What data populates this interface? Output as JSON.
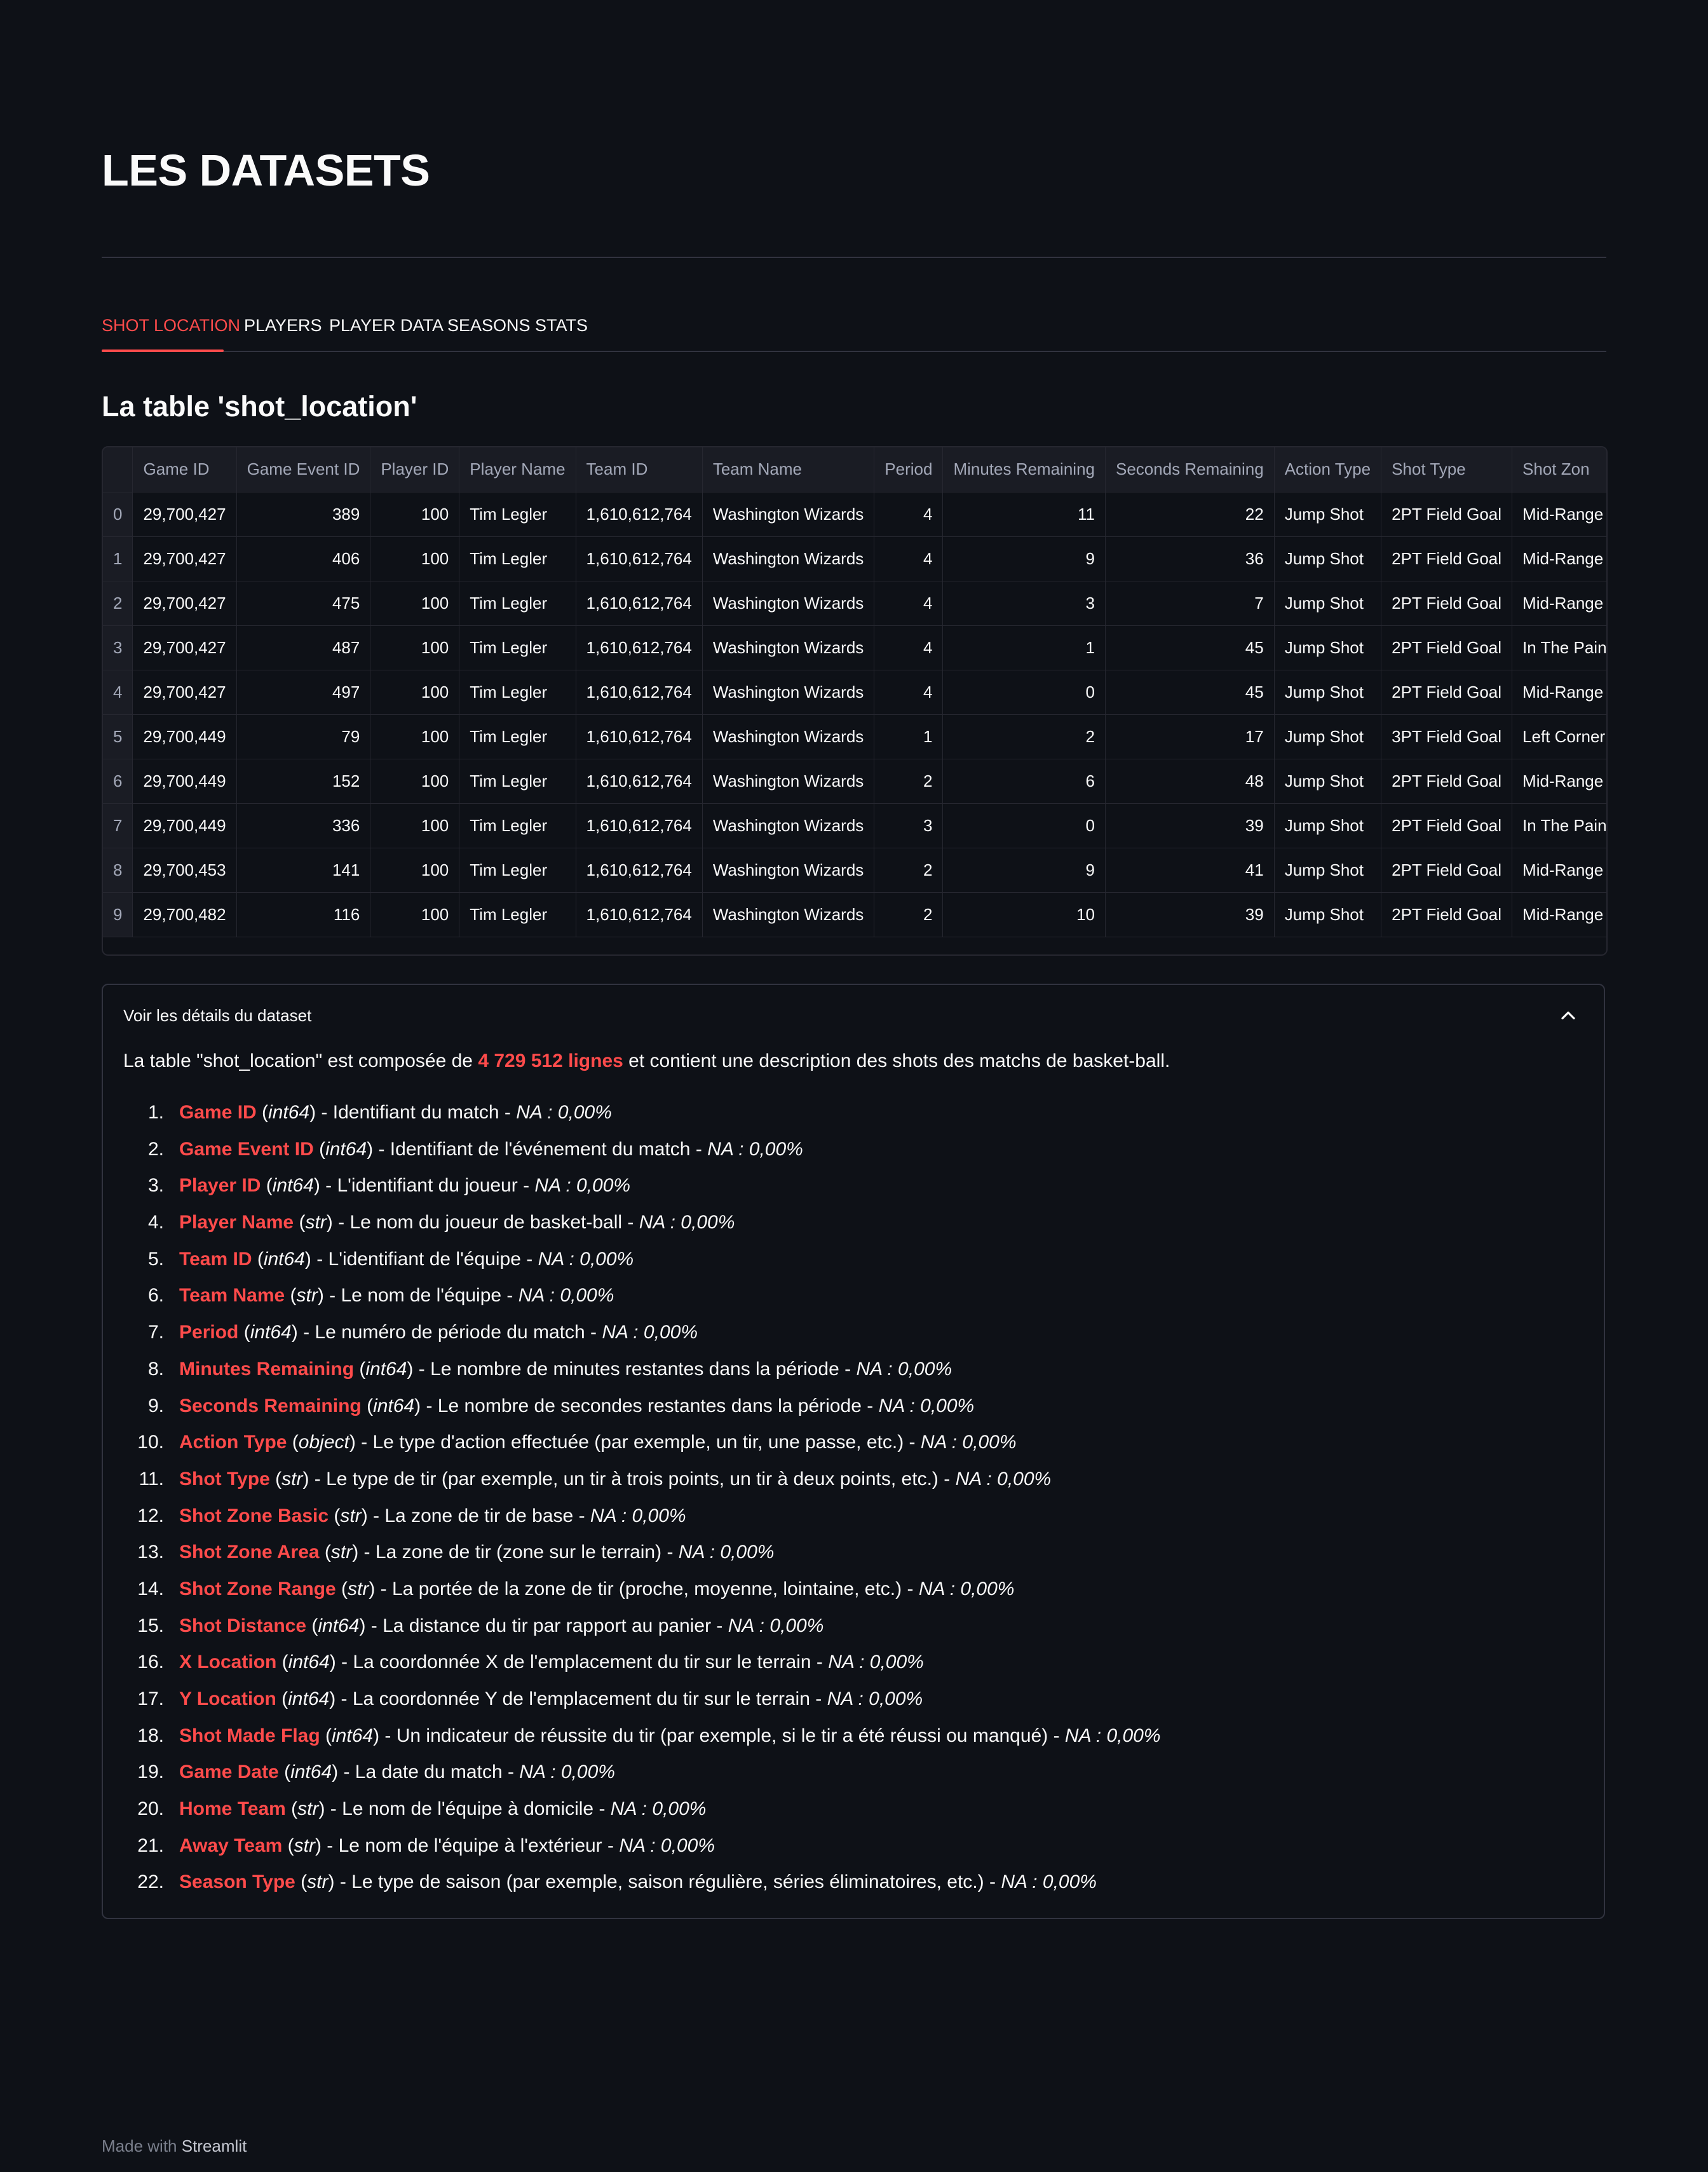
{
  "page": {
    "title": "LES DATASETS"
  },
  "tabs": [
    {
      "label": "SHOT LOCATION",
      "active": true
    },
    {
      "label": "PLAYERS",
      "active": false
    },
    {
      "label": "PLAYER DATA",
      "active": false
    },
    {
      "label": "SEASONS STATS",
      "active": false
    }
  ],
  "section": {
    "title": "La table 'shot_location'"
  },
  "table": {
    "columns": [
      "",
      "Game ID",
      "Game Event ID",
      "Player ID",
      "Player Name",
      "Team ID",
      "Team Name",
      "Period",
      "Minutes Remaining",
      "Seconds Remaining",
      "Action Type",
      "Shot Type",
      "Shot Zon"
    ],
    "rows": [
      [
        "0",
        "29,700,427",
        "389",
        "100",
        "Tim Legler",
        "1,610,612,764",
        "Washington Wizards",
        "4",
        "11",
        "22",
        "Jump Shot",
        "2PT Field Goal",
        "Mid-Range"
      ],
      [
        "1",
        "29,700,427",
        "406",
        "100",
        "Tim Legler",
        "1,610,612,764",
        "Washington Wizards",
        "4",
        "9",
        "36",
        "Jump Shot",
        "2PT Field Goal",
        "Mid-Range"
      ],
      [
        "2",
        "29,700,427",
        "475",
        "100",
        "Tim Legler",
        "1,610,612,764",
        "Washington Wizards",
        "4",
        "3",
        "7",
        "Jump Shot",
        "2PT Field Goal",
        "Mid-Range"
      ],
      [
        "3",
        "29,700,427",
        "487",
        "100",
        "Tim Legler",
        "1,610,612,764",
        "Washington Wizards",
        "4",
        "1",
        "45",
        "Jump Shot",
        "2PT Field Goal",
        "In The Paint"
      ],
      [
        "4",
        "29,700,427",
        "497",
        "100",
        "Tim Legler",
        "1,610,612,764",
        "Washington Wizards",
        "4",
        "0",
        "45",
        "Jump Shot",
        "2PT Field Goal",
        "Mid-Range"
      ],
      [
        "5",
        "29,700,449",
        "79",
        "100",
        "Tim Legler",
        "1,610,612,764",
        "Washington Wizards",
        "1",
        "2",
        "17",
        "Jump Shot",
        "3PT Field Goal",
        "Left Corner"
      ],
      [
        "6",
        "29,700,449",
        "152",
        "100",
        "Tim Legler",
        "1,610,612,764",
        "Washington Wizards",
        "2",
        "6",
        "48",
        "Jump Shot",
        "2PT Field Goal",
        "Mid-Range"
      ],
      [
        "7",
        "29,700,449",
        "336",
        "100",
        "Tim Legler",
        "1,610,612,764",
        "Washington Wizards",
        "3",
        "0",
        "39",
        "Jump Shot",
        "2PT Field Goal",
        "In The Paint"
      ],
      [
        "8",
        "29,700,453",
        "141",
        "100",
        "Tim Legler",
        "1,610,612,764",
        "Washington Wizards",
        "2",
        "9",
        "41",
        "Jump Shot",
        "2PT Field Goal",
        "Mid-Range"
      ],
      [
        "9",
        "29,700,482",
        "116",
        "100",
        "Tim Legler",
        "1,610,612,764",
        "Washington Wizards",
        "2",
        "10",
        "39",
        "Jump Shot",
        "2PT Field Goal",
        "Mid-Range"
      ]
    ]
  },
  "expander": {
    "label": "Voir les détails du dataset",
    "intro_before": "La table \"shot_location\" est composée de ",
    "intro_highlight": "4 729 512 lignes",
    "intro_after": " et contient une description des shots des matchs de basket-ball.",
    "fields": [
      {
        "name": "Game ID",
        "type": "int64",
        "desc": "Identifiant du match",
        "na": "NA : 0,00%"
      },
      {
        "name": "Game Event ID",
        "type": "int64",
        "desc": "Identifiant de l'événement du match",
        "na": "NA : 0,00%"
      },
      {
        "name": "Player ID",
        "type": "int64",
        "desc": "L'identifiant du joueur",
        "na": "NA : 0,00%"
      },
      {
        "name": "Player Name",
        "type": "str",
        "desc": "Le nom du joueur de basket-ball",
        "na": "NA : 0,00%"
      },
      {
        "name": "Team ID",
        "type": "int64",
        "desc": "L'identifiant de l'équipe",
        "na": "NA : 0,00%"
      },
      {
        "name": "Team Name",
        "type": "str",
        "desc": "Le nom de l'équipe",
        "na": "NA : 0,00%"
      },
      {
        "name": "Period",
        "type": "int64",
        "desc": "Le numéro de période du match",
        "na": "NA : 0,00%"
      },
      {
        "name": "Minutes Remaining",
        "type": "int64",
        "desc": "Le nombre de minutes restantes dans la période",
        "na": "NA : 0,00%"
      },
      {
        "name": "Seconds Remaining",
        "type": "int64",
        "desc": "Le nombre de secondes restantes dans la période",
        "na": "NA : 0,00%"
      },
      {
        "name": "Action Type",
        "type": "object",
        "desc": "Le type d'action effectuée (par exemple, un tir, une passe, etc.)",
        "na": "NA : 0,00%"
      },
      {
        "name": "Shot Type",
        "type": "str",
        "desc": "Le type de tir (par exemple, un tir à trois points, un tir à deux points, etc.)",
        "na": "NA : 0,00%"
      },
      {
        "name": "Shot Zone Basic",
        "type": "str",
        "desc": "La zone de tir de base",
        "na": "NA : 0,00%"
      },
      {
        "name": "Shot Zone Area",
        "type": "str",
        "desc": "La zone de tir (zone sur le terrain)",
        "na": "NA : 0,00%"
      },
      {
        "name": "Shot Zone Range",
        "type": "str",
        "desc": "La portée de la zone de tir (proche, moyenne, lointaine, etc.)",
        "na": "NA : 0,00%"
      },
      {
        "name": "Shot Distance",
        "type": "int64",
        "desc": "La distance du tir par rapport au panier",
        "na": "NA : 0,00%"
      },
      {
        "name": "X Location",
        "type": "int64",
        "desc": "La coordonnée X de l'emplacement du tir sur le terrain",
        "na": "NA : 0,00%"
      },
      {
        "name": "Y Location",
        "type": "int64",
        "desc": "La coordonnée Y de l'emplacement du tir sur le terrain",
        "na": "NA : 0,00%"
      },
      {
        "name": "Shot Made Flag",
        "type": "int64",
        "desc": "Un indicateur de réussite du tir (par exemple, si le tir a été réussi ou manqué)",
        "na": "NA : 0,00%"
      },
      {
        "name": "Game Date",
        "type": "int64",
        "desc": "La date du match",
        "na": "NA : 0,00%"
      },
      {
        "name": "Home Team",
        "type": "str",
        "desc": "Le nom de l'équipe à domicile",
        "na": "NA : 0,00%"
      },
      {
        "name": "Away Team",
        "type": "str",
        "desc": "Le nom de l'équipe à l'extérieur",
        "na": "NA : 0,00%"
      },
      {
        "name": "Season Type",
        "type": "str",
        "desc": "Le type de saison (par exemple, saison régulière, séries éliminatoires, etc.)",
        "na": "NA : 0,00%"
      }
    ]
  },
  "footer": {
    "prefix": "Made with",
    "brand": "Streamlit"
  },
  "colors": {
    "background": "#0e1117",
    "accent": "#ff4b4b",
    "text": "#fafafa",
    "muted": "#a3a8b8"
  }
}
